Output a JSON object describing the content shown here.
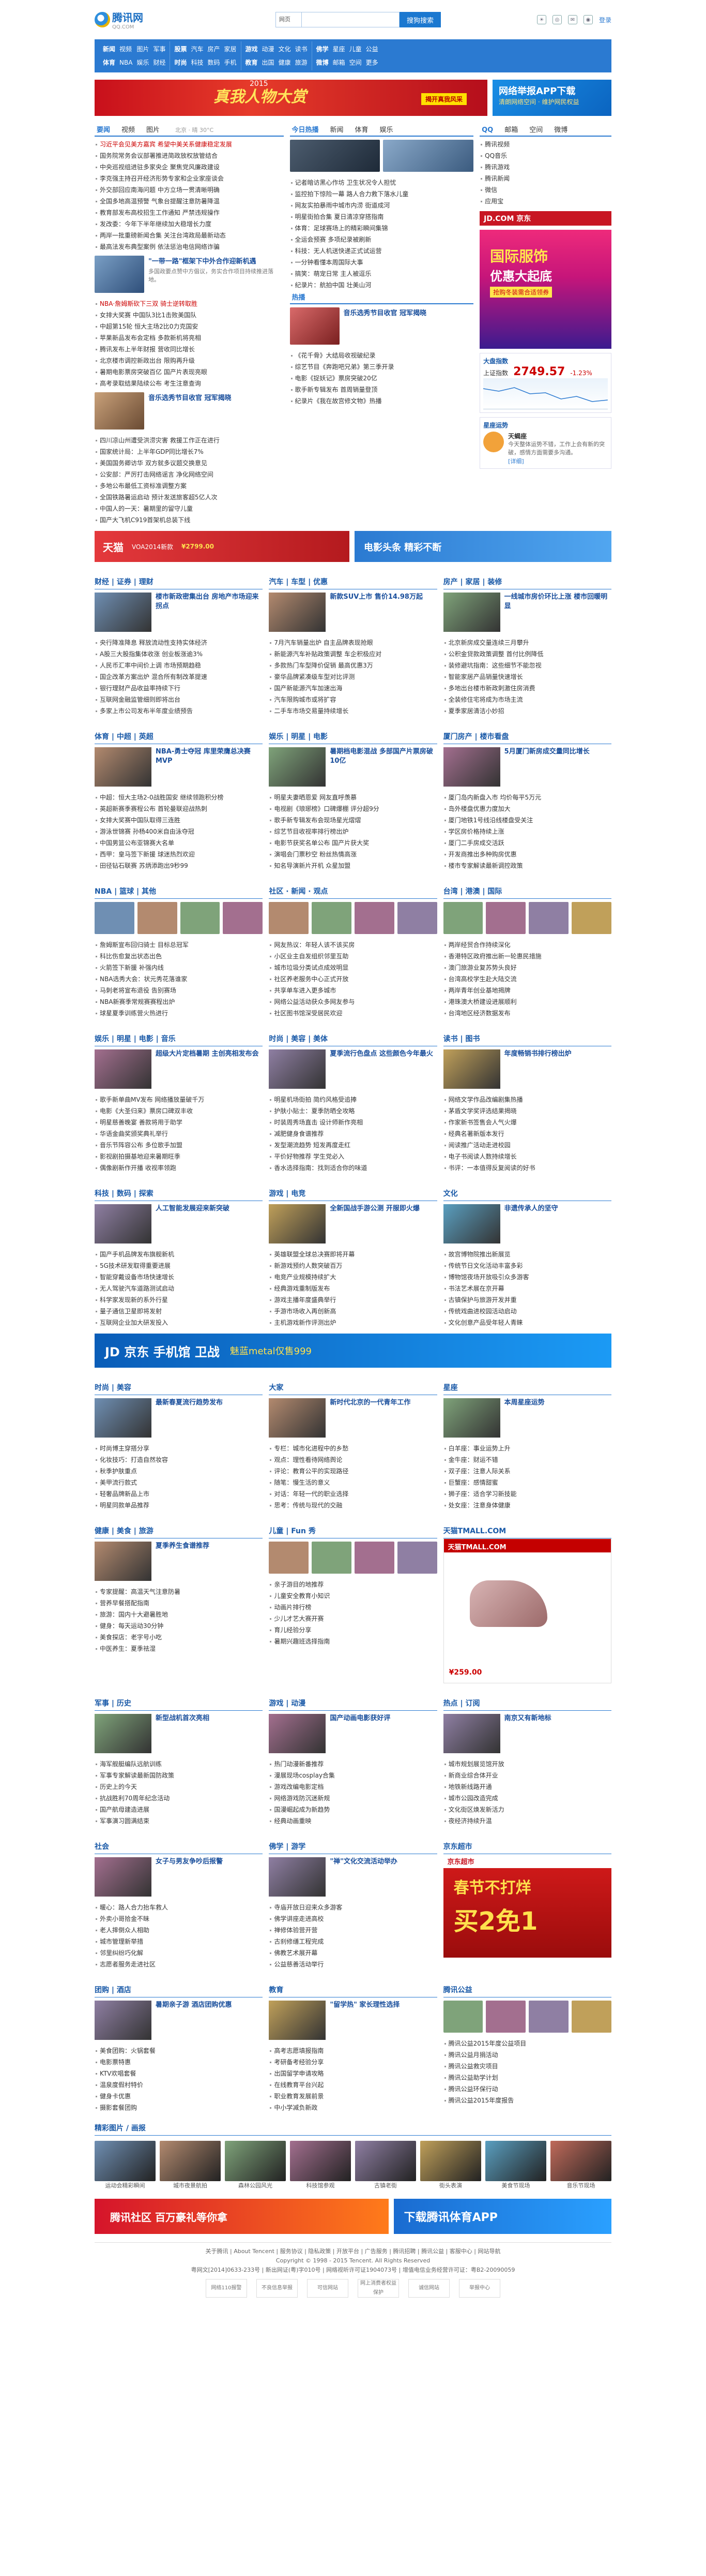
{
  "header": {
    "logo_text": "腾讯网",
    "logo_sub": "QQ.COM",
    "search_scope": "网页",
    "search_placeholder": "",
    "search_button": "搜狗搜索",
    "icons": [
      "weather-icon",
      "qq-icon",
      "mail-icon",
      "weibo-icon"
    ],
    "login": "登录"
  },
  "nav": [
    [
      "新闻",
      "视频",
      "图片",
      "军事",
      "体育",
      "NBA",
      "娱乐",
      "财经"
    ],
    [
      "股票",
      "汽车",
      "房产",
      "家居",
      "时尚",
      "科技",
      "数码",
      "手机"
    ],
    [
      "游戏",
      "动漫",
      "文化",
      "读书",
      "教育",
      "出国",
      "健康",
      "旅游"
    ],
    [
      "佛学",
      "星座",
      "儿童",
      "公益",
      "微博",
      "邮箱",
      "空间",
      "更多"
    ]
  ],
  "banner": {
    "year": "2015",
    "headline": "真我人物大赏",
    "cta": "揭开真我风采",
    "side_title": "网络举报APP下载",
    "side_sub": "清朗网络空间 · 维护网民权益"
  },
  "news": {
    "tabs": [
      "要闻",
      "视频",
      "图片"
    ],
    "weather": "北京 · 晴 30°C",
    "items": [
      "习近平会见美方嘉宾 希望中美关系健康稳定发展",
      "国务院常务会议部署推进简政放权放管结合",
      "中央巡视组进驻多家央企 聚焦党风廉政建设",
      "李克强主持召开经济形势专家和企业家座谈会",
      "外交部回应南海问题 中方立场一贯清晰明确",
      "全国多地高温预警 气象台提醒注意防暑降温",
      "教育部发布高校招生工作通知 严禁违规操作",
      "发改委：今年下半年继续加大稳增长力度",
      "两岸一批重磅新闻合集 关注台湾政局最新动态",
      "最高法发布典型案例 依法惩治电信网络诈骗"
    ],
    "feature_title": "\"一带一路\"框架下中外合作迎新机遇",
    "feature_desc": "多国政要点赞中方倡议，务实合作项目持续推进落地。",
    "more_items": [
      "NBA·詹姆斯砍下三双 骑士逆转取胜",
      "女排大奖赛 中国队3比1击败美国队",
      "中超第15轮 恒大主场2比0力克国安",
      "苹果新品发布会定档 多款新机将亮相",
      "腾讯发布上半年财报 营收同比增长",
      "北京楼市调控新政出台 限购再升级",
      "暑期电影票房突破百亿 国产片表现亮眼",
      "高考录取结果陆续公布 考生注意查询"
    ],
    "bottom_items": [
      "四川凉山州遭受洪涝灾害 救援工作正在进行",
      "国家统计局：上半年GDP同比增长7%",
      "美国国务卿访华 双方就多议题交换意见",
      "公安部：严厉打击网络谣言 净化网络空间",
      "多地公布最低工资标准调整方案",
      "全国铁路暑运启动 预计发送旅客超5亿人次",
      "中国人的一天：暑期里的留守儿童",
      "国产大飞机C919首架机总装下线"
    ]
  },
  "video": {
    "tabs": [
      "今日热播",
      "新闻",
      "体育",
      "娱乐"
    ],
    "items": [
      "记者暗访黑心作坊 卫生状况令人担忧",
      "监控拍下惊险一幕 路人合力救下落水儿童",
      "网友实拍暴雨中城市内涝 街道成河",
      "明星街拍合集 夏日清凉穿搭指南",
      "体育：足球赛场上的精彩瞬间集锦",
      "全运会预赛 多项纪录被刷新",
      "科技：无人机送快递正式试运营",
      "一分钟看懂本周国际大事",
      "搞笑：萌宠日常 主人被逗乐",
      "纪录片：航拍中国 壮美山河"
    ],
    "hot_title": "热播",
    "hot_feature": "音乐选秀节目收官 冠军揭晓",
    "hot_items": [
      "《花千骨》大结局收视破纪录",
      "综艺节目《奔跑吧兄弟》第三季开录",
      "电影《捉妖记》票房突破20亿",
      "歌手新专辑发布 首周销量登顶",
      "纪录片《我在故宫修文物》热播"
    ]
  },
  "right_news": {
    "tabs": [
      "QQ",
      "邮箱",
      "空间",
      "微博",
      "游戏",
      "电脑管家"
    ],
    "links": [
      "腾讯视频",
      "QQ音乐",
      "腾讯游戏",
      "腾讯新闻",
      "微信",
      "应用宝",
      "财付通",
      "QQ浏览器"
    ],
    "jd_label": "JD.COM 京东",
    "ad_line1": "国际服饰",
    "ad_line2": "优惠大起底",
    "ad_line3": "抢购冬装需合适领券",
    "stock_title": "大盘指数",
    "stock_name": "上证指数",
    "stock_value": "2749.57",
    "stock_change": "-1.23%",
    "horoscope_title": "星座运势",
    "horoscope_name": "天蝎座",
    "horoscope_desc": "今天整体运势不错，工作上会有新的突破，感情方面需要多沟通。",
    "horoscope_more": "[详细]"
  },
  "wide_ads": {
    "left": "天猫",
    "left_sub": "VOA2014新款",
    "price": "¥2799.00",
    "right": "电影头条 精彩不断"
  },
  "sections1": [
    {
      "title": "财经 | 证券 | 理财",
      "feature": "楼市新政密集出台 房地产市场迎来拐点",
      "items": [
        "央行降准降息 释放流动性支持实体经济",
        "A股三大股指集体收涨 创业板涨逾3%",
        "人民币汇率中间价上调 市场预期趋稳",
        "国企改革方案出炉 混合所有制改革提速",
        "银行理财产品收益率持续下行",
        "互联网金融监管细则即将出台",
        "多家上市公司发布半年度业绩预告"
      ]
    },
    {
      "title": "汽车 | 车型 | 优惠",
      "feature": "新款SUV上市 售价14.98万起",
      "items": [
        "7月汽车销量出炉 自主品牌表现抢眼",
        "新能源汽车补贴政策调整 车企积极应对",
        "多款热门车型降价促销 最高优惠3万",
        "豪华品牌紧凑级车型对比评测",
        "国产新能源汽车加速出海",
        "汽车限购城市或将扩容",
        "二手车市场交易量持续增长"
      ]
    },
    {
      "title": "房产 | 家居 | 装修",
      "feature": "一线城市房价环比上涨 楼市回暖明显",
      "items": [
        "北京新房成交量连续三月攀升",
        "公积金贷款政策调整 首付比例降低",
        "装修避坑指南：这些细节不能忽视",
        "智能家居产品销量快速增长",
        "多地出台楼市新政刺激住房消费",
        "全装修住宅将成为市场主流",
        "夏季家居清洁小妙招"
      ]
    }
  ],
  "sections2": [
    {
      "title": "体育 | 中超 | 英超",
      "feature": "NBA-勇士夺冠 库里荣膺总决赛MVP",
      "items": [
        "中超：恒大主场2-0战胜国安 继续领跑积分榜",
        "英超新赛季赛程公布 首轮曼联迎战热刺",
        "女排大奖赛中国队取得三连胜",
        "游泳世锦赛 孙杨400米自由泳夺冠",
        "中国男篮公布亚锦赛大名单",
        "西甲：皇马签下新援 球迷热烈欢迎",
        "田径钻石联赛 苏炳添跑出9秒99"
      ]
    },
    {
      "title": "娱乐 | 明星 | 电影",
      "feature": "暑期档电影混战 多部国产片票房破10亿",
      "items": [
        "明星夫妻晒恩爱 网友直呼羡慕",
        "电视剧《琅琊榜》口碑爆棚 评分超9分",
        "歌手新专辑发布会现场星光熠熠",
        "综艺节目收视率排行榜出炉",
        "电影节获奖名单公布 国产片获大奖",
        "演唱会门票秒空 粉丝热情高涨",
        "知名导演新片开机 众星加盟"
      ]
    },
    {
      "title": "厦门房产 | 楼市看盘",
      "feature": "5月厦门新房成交量同比增长",
      "items": [
        "厦门岛内新盘入市 均价每平5万元",
        "岛外楼盘优惠力度加大",
        "厦门地铁1号线沿线楼盘受关注",
        "学区房价格持续上涨",
        "厦门二手房成交活跃",
        "开发商推出多种购房优惠",
        "楼市专家解读最新调控政策"
      ]
    }
  ],
  "sections3": [
    {
      "title": "NBA | 篮球 | 其他",
      "items": [
        "詹姆斯宣布回归骑士 目标总冠军",
        "科比伤愈复出状态出色",
        "火箭签下新援 补强内线",
        "NBA选秀大会：状元秀花落谁家",
        "马刺老将宣布退役 告别赛场",
        "NBA新赛季常规赛赛程出炉",
        "球星夏季训练营火热进行"
      ]
    },
    {
      "title": "社区 · 新闻 · 观点",
      "items": [
        "网友热议：年轻人该不该买房",
        "小区业主自发组织邻里互助",
        "城市垃圾分类试点成效明显",
        "社区养老服务中心正式开放",
        "共享单车进入更多城市",
        "网络公益活动获众多网友参与",
        "社区图书馆深受居民欢迎"
      ]
    },
    {
      "title": "台湾 | 港澳 | 国际",
      "items": [
        "两岸经贸合作持续深化",
        "香港特区政府推出新一轮惠民措施",
        "澳门旅游业复苏势头良好",
        "台湾高校学生赴大陆交流",
        "两岸青年创业基地揭牌",
        "港珠澳大桥建设进展顺利",
        "台湾地区经济数据发布"
      ]
    }
  ],
  "sections4": [
    {
      "title": "娱乐 | 明星 | 电影 | 音乐",
      "feature": "超级大片定档暑期 主创亮相发布会",
      "items": [
        "歌手新单曲MV发布 网络播放量破千万",
        "电影《大圣归来》票房口碑双丰收",
        "明星慈善晚宴 善款将用于助学",
        "华语金曲奖颁奖典礼举行",
        "音乐节阵容公布 多位歌手加盟",
        "影视剧拍摄基地迎来暑期旺季",
        "偶像剧新作开播 收视率领跑"
      ]
    },
    {
      "title": "时尚 | 美容 | 美体",
      "feature": "夏季流行色盘点 这些颜色今年最火",
      "items": [
        "明星机场街拍 简约风格受追捧",
        "护肤小贴士：夏季防晒全攻略",
        "时装周秀场直击 设计师新作亮相",
        "减肥健身食谱推荐",
        "发型潮流趋势 短发再度走红",
        "平价好物推荐 学生党必入",
        "香水选择指南：找到适合你的味道"
      ]
    },
    {
      "title": "读书 | 图书",
      "feature": "年度畅销书排行榜出炉",
      "items": [
        "网络文学作品改编剧集热播",
        "茅盾文学奖评选结果揭晓",
        "作家新书签售会人气火爆",
        "经典名著新版本发行",
        "阅读推广活动走进校园",
        "电子书阅读人数持续增长",
        "书评：一本值得反复阅读的好书"
      ]
    }
  ],
  "sections5": [
    {
      "title": "科技 | 数码 | 探索",
      "feature": "人工智能发展迎来新突破",
      "items": [
        "国产手机品牌发布旗舰新机",
        "5G技术研发取得重要进展",
        "智能穿戴设备市场快速增长",
        "无人驾驶汽车道路测试启动",
        "科学家发现新的系外行星",
        "量子通信卫星即将发射",
        "互联网企业加大研发投入"
      ]
    },
    {
      "title": "游戏 | 电竞",
      "feature": "全新国战手游公测 开服即火爆",
      "items": [
        "英雄联盟全球总决赛即将开幕",
        "新游戏预约人数突破百万",
        "电竞产业规模持续扩大",
        "经典游戏重制版发布",
        "游戏主播年度盛典举行",
        "手游市场收入再创新高",
        "主机游戏新作评测出炉"
      ]
    },
    {
      "title": "文化",
      "feature": "非遗传承人的坚守",
      "items": [
        "故宫博物院推出新展览",
        "传统节日文化活动丰富多彩",
        "博物馆夜场开放吸引众多游客",
        "书法艺术展在京开幕",
        "古镇保护与旅游开发并重",
        "传统戏曲进校园活动启动",
        "文化创意产品受年轻人青睐"
      ]
    }
  ],
  "mid_banner": {
    "left": "JD 京东 手机馆 卫战",
    "text": "魅蓝metal仅售999"
  },
  "sections6": [
    {
      "title": "时尚 | 美容",
      "feature": "最新春夏流行趋势发布",
      "items": [
        "时尚博主穿搭分享",
        "化妆技巧：打造自然妆容",
        "秋季护肤重点",
        "美甲流行款式",
        "轻奢品牌新品上市",
        "明星同款单品推荐"
      ]
    },
    {
      "title": "大家",
      "feature": "新时代北京的一代青年工作",
      "items": [
        "专栏：城市化进程中的乡愁",
        "观点：理性看待网络舆论",
        "评论：教育公平的实现路径",
        "随笔：慢生活的意义",
        "对话：年轻一代的职业选择",
        "思考：传统与现代的交融"
      ]
    },
    {
      "title": "星座",
      "feature": "本周星座运势",
      "items": [
        "白羊座：事业运势上升",
        "金牛座：财运不错",
        "双子座：注意人际关系",
        "巨蟹座：感情甜蜜",
        "狮子座：适合学习新技能",
        "处女座：注意身体健康"
      ]
    }
  ],
  "sections7": [
    {
      "title": "健康 | 美食 | 旅游",
      "feature": "夏季养生食谱推荐",
      "items": [
        "专家提醒：高温天气注意防暑",
        "营养早餐搭配指南",
        "旅游：国内十大避暑胜地",
        "健身：每天运动30分钟",
        "美食探店：老字号小吃",
        "中医养生：夏季祛湿"
      ]
    },
    {
      "title": "儿童 | Fun 秀",
      "feature": "",
      "items": [
        "亲子游目的地推荐",
        "儿童安全教育小知识",
        "动画片排行榜",
        "少儿才艺大赛开赛",
        "育儿经验分享",
        "暑期兴趣班选择指南"
      ]
    },
    {
      "title": "天猫TMALL.COM",
      "feature": "",
      "items": []
    }
  ],
  "tmall": {
    "label": "天猫TMALL.COM",
    "price": "¥259.00"
  },
  "sections8": [
    {
      "title": "军事 | 历史",
      "feature": "新型战机首次亮相",
      "items": [
        "海军舰艇编队远航训练",
        "军事专家解读最新国防政策",
        "历史上的今天",
        "抗战胜利70周年纪念活动",
        "国产航母建造进展",
        "军事演习圆满结束"
      ]
    },
    {
      "title": "游戏 | 动漫",
      "feature": "国产动画电影获好评",
      "items": [
        "热门动漫新番推荐",
        "漫展现场cosplay合集",
        "游戏改编电影定档",
        "网络游戏防沉迷新规",
        "国漫崛起成为新趋势",
        "经典动画重映"
      ]
    },
    {
      "title": "热点 | 订阅",
      "feature": "南京又有新地标",
      "items": [
        "城市规划展览馆开放",
        "新商业综合体开业",
        "地铁新线路开通",
        "城市公园改造完成",
        "文化街区焕发新活力",
        "夜经济持续升温"
      ]
    }
  ],
  "sections9": [
    {
      "title": "社会",
      "feature": "女子与男友争吵后报警",
      "items": [
        "暖心：路人合力抬车救人",
        "外卖小哥拾金不昧",
        "老人摔倒众人相助",
        "城市管理新举措",
        "邻里纠纷巧化解",
        "志愿者服务走进社区"
      ]
    },
    {
      "title": "佛学 | 游学",
      "feature": "\"禅\"文化交流活动举办",
      "items": [
        "寺庙开放日迎来众多游客",
        "佛学讲座走进高校",
        "禅修体验营开营",
        "古刹修缮工程完成",
        "佛教艺术展开幕",
        "公益慈善活动举行"
      ]
    },
    {
      "title": "京东超市",
      "feature": "",
      "items": []
    }
  ],
  "jd_ad": {
    "label": "京东超市",
    "line1": "春节不打烊",
    "line2": "买2免1"
  },
  "sections10": [
    {
      "title": "团购 | 酒店",
      "feature": "暑期亲子游 酒店团购优惠",
      "items": [
        "美食团购：火锅套餐",
        "电影票特惠",
        "KTV欢唱套餐",
        "温泉度假村特价",
        "健身卡优惠",
        "摄影套餐团购"
      ]
    },
    {
      "title": "教育",
      "feature": "\"留学热\" 家长理性选择",
      "items": [
        "高考志愿填报指南",
        "考研备考经验分享",
        "出国留学申请攻略",
        "在线教育平台兴起",
        "职业教育发展前景",
        "中小学减负新政"
      ]
    },
    {
      "title": "腾讯公益",
      "feature": "",
      "items": [
        "腾讯公益2015年度公益项目",
        "腾讯公益月捐活动",
        "腾讯公益救灾项目",
        "腾讯公益助学计划",
        "腾讯公益环保行动",
        "腾讯公益2015年度报告"
      ]
    }
  ],
  "photos": {
    "title": "精彩图片 / 画报",
    "items": [
      "运动会精彩瞬间",
      "城市夜景航拍",
      "森林公园风光",
      "科技馆参观",
      "古镇老街",
      "街头表演",
      "美食节现场",
      "音乐节现场"
    ]
  },
  "bottom_banners": {
    "left": "腾讯社区 百万豪礼等你拿",
    "right": "下载腾讯体育APP"
  },
  "footer": {
    "line1": "关于腾讯 | About Tencent | 服务协议 | 隐私政策 | 开放平台 | 广告服务 | 腾讯招聘 | 腾讯公益 | 客服中心 | 网站导航",
    "line2": "Copyright © 1998 - 2015 Tencent. All Rights Reserved",
    "line3": "粤网文[2014]0633-233号 | 新出网证(粤)字010号 | 网络视听许可证1904073号 | 增值电信业务经营许可证：粤B2-20090059",
    "badges": [
      "网络110报警",
      "不良信息举报",
      "可信网站",
      "网上消费者权益保护",
      "诚信网站",
      "举报中心"
    ]
  }
}
